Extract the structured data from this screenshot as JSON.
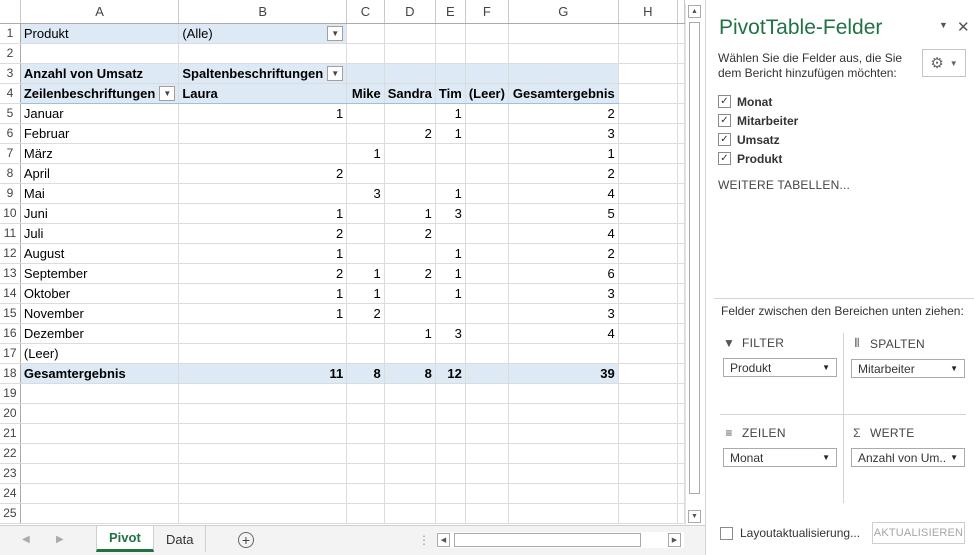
{
  "columns": [
    "A",
    "B",
    "C",
    "D",
    "E",
    "F",
    "G",
    "H"
  ],
  "rows": [
    {
      "n": "1",
      "cells": {
        "A": "Produkt",
        "B": "(Alle)"
      }
    },
    {
      "n": "2",
      "cells": {}
    },
    {
      "n": "3",
      "cells": {
        "A": "Anzahl von Umsatz",
        "B": "Spaltenbeschriftungen"
      }
    },
    {
      "n": "4",
      "cells": {
        "A": "Zeilenbeschriftungen",
        "B": "Laura",
        "C": "Mike",
        "D": "Sandra",
        "E": "Tim",
        "F": "(Leer)",
        "G": "Gesamtergebnis"
      }
    },
    {
      "n": "5",
      "cells": {
        "A": "Januar",
        "B": "1",
        "E": "1",
        "G": "2"
      }
    },
    {
      "n": "6",
      "cells": {
        "A": "Februar",
        "D": "2",
        "E": "1",
        "G": "3"
      }
    },
    {
      "n": "7",
      "cells": {
        "A": "März",
        "C": "1",
        "G": "1"
      }
    },
    {
      "n": "8",
      "cells": {
        "A": "April",
        "B": "2",
        "G": "2"
      }
    },
    {
      "n": "9",
      "cells": {
        "A": "Mai",
        "C": "3",
        "E": "1",
        "G": "4"
      }
    },
    {
      "n": "10",
      "cells": {
        "A": "Juni",
        "B": "1",
        "D": "1",
        "E": "3",
        "G": "5"
      }
    },
    {
      "n": "11",
      "cells": {
        "A": "Juli",
        "B": "2",
        "D": "2",
        "G": "4"
      }
    },
    {
      "n": "12",
      "cells": {
        "A": "August",
        "B": "1",
        "E": "1",
        "G": "2"
      }
    },
    {
      "n": "13",
      "cells": {
        "A": "September",
        "B": "2",
        "C": "1",
        "D": "2",
        "E": "1",
        "G": "6"
      }
    },
    {
      "n": "14",
      "cells": {
        "A": "Oktober",
        "B": "1",
        "C": "1",
        "E": "1",
        "G": "3"
      }
    },
    {
      "n": "15",
      "cells": {
        "A": "November",
        "B": "1",
        "C": "2",
        "G": "3"
      }
    },
    {
      "n": "16",
      "cells": {
        "A": "Dezember",
        "D": "1",
        "E": "3",
        "G": "4"
      }
    },
    {
      "n": "17",
      "cells": {
        "A": "(Leer)"
      }
    },
    {
      "n": "18",
      "cells": {
        "A": "Gesamtergebnis",
        "B": "11",
        "C": "8",
        "D": "8",
        "E": "12",
        "G": "39"
      }
    },
    {
      "n": "19",
      "cells": {}
    },
    {
      "n": "20",
      "cells": {}
    },
    {
      "n": "21",
      "cells": {}
    },
    {
      "n": "22",
      "cells": {}
    },
    {
      "n": "23",
      "cells": {}
    },
    {
      "n": "24",
      "cells": {}
    },
    {
      "n": "25",
      "cells": {}
    }
  ],
  "sheet_tabs": [
    "Pivot",
    "Data"
  ],
  "active_tab": "Pivot",
  "pane": {
    "title": "PivotTable-Felder",
    "description": "Wählen Sie die Felder aus, die Sie dem Bericht hinzufügen möchten:",
    "fields": [
      {
        "label": "Monat",
        "checked": true
      },
      {
        "label": "Mitarbeiter",
        "checked": true
      },
      {
        "label": "Umsatz",
        "checked": true
      },
      {
        "label": "Produkt",
        "checked": true
      }
    ],
    "more_tables": "WEITERE TABELLEN...",
    "drag_instruction": "Felder zwischen den Bereichen unten ziehen:",
    "areas": {
      "filter": {
        "label": "FILTER",
        "value": "Produkt",
        "icon": "filter-icon"
      },
      "columns": {
        "label": "SPALTEN",
        "value": "Mitarbeiter",
        "icon": "columns-icon"
      },
      "rows": {
        "label": "ZEILEN",
        "value": "Monat",
        "icon": "rows-icon"
      },
      "values": {
        "label": "WERTE",
        "value": "Anzahl von Um...",
        "icon": "sigma-icon"
      }
    },
    "layout_update_label": "Layoutaktualisierung...",
    "update_button": "AKTUALISIEREN"
  },
  "colors": {
    "accent": "#217346",
    "pivot_header": "#dde9f5"
  }
}
